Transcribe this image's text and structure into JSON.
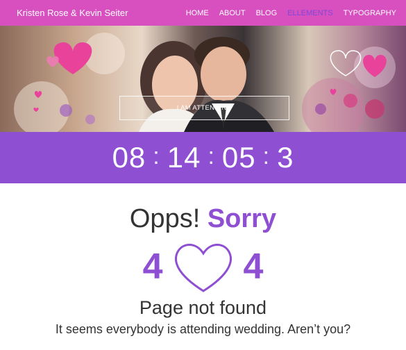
{
  "header": {
    "brand": "Kristen Rose & Kevin Seiter",
    "nav": [
      {
        "label": "HOME"
      },
      {
        "label": "ABOUT"
      },
      {
        "label": "BLOG"
      },
      {
        "label": "ELLEMENTS"
      },
      {
        "label": "TYPOGRAPHY"
      }
    ],
    "active_index": 3
  },
  "hero": {
    "button_label": "I AM ATTENDING"
  },
  "countdown": {
    "hours": "08",
    "minutes": "14",
    "seconds": "05",
    "tail": "3",
    "separator": ":"
  },
  "error": {
    "opps": "Opps!",
    "sorry": "Sorry",
    "code_left": "4",
    "code_right": "4",
    "title": "Page not found",
    "message": "It seems everybody is attending wedding. Aren’t you?"
  },
  "colors": {
    "nav_bg": "#d84fc0",
    "accent_purple": "#8e4fd2",
    "heart_pink": "#e8429a"
  }
}
